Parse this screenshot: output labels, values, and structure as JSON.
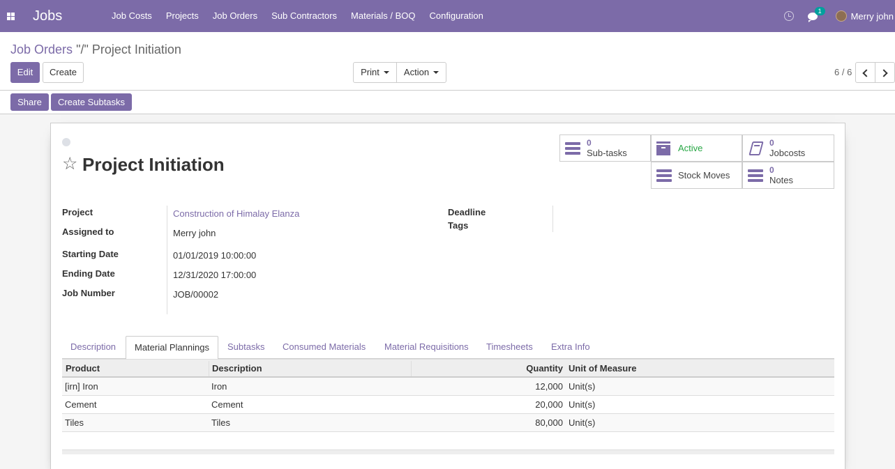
{
  "navbar": {
    "brand": "Jobs",
    "menu": [
      "Job Costs",
      "Projects",
      "Job Orders",
      "Sub Contractors",
      "Materials / BOQ",
      "Configuration"
    ],
    "chat_count": "1",
    "user_name": "Merry john"
  },
  "breadcrumb": {
    "parent": "Job Orders",
    "current": "\"/\" Project Initiation"
  },
  "actions": {
    "edit": "Edit",
    "create": "Create",
    "print": "Print",
    "action": "Action",
    "pager": "6 / 6"
  },
  "header_buttons": {
    "share": "Share",
    "create_subtasks": "Create Subtasks"
  },
  "smart_buttons": {
    "subtasks_count": "0",
    "subtasks_label": "Sub-tasks",
    "active_label": "Active",
    "jobcosts_count": "0",
    "jobcosts_label": "Jobcosts",
    "stock_moves_label": "Stock Moves",
    "notes_count": "0",
    "notes_label": "Notes"
  },
  "record": {
    "title": "Project Initiation"
  },
  "fields": {
    "project_label": "Project",
    "project_value": "Construction of Himalay Elanza",
    "assigned_label": "Assigned to",
    "assigned_value": "Merry john",
    "start_label": "Starting Date",
    "start_value": "01/01/2019 10:00:00",
    "end_label": "Ending Date",
    "end_value": "12/31/2020 17:00:00",
    "jobnum_label": "Job Number",
    "jobnum_value": "JOB/00002",
    "deadline_label": "Deadline",
    "tags_label": "Tags"
  },
  "tabs": [
    "Description",
    "Material Plannings",
    "Subtasks",
    "Consumed Materials",
    "Material Requisitions",
    "Timesheets",
    "Extra Info"
  ],
  "table": {
    "headers": [
      "Product",
      "Description",
      "Quantity",
      "Unit of Measure"
    ],
    "rows": [
      [
        "[irn] Iron",
        "Iron",
        "12,000",
        "Unit(s)"
      ],
      [
        "Cement",
        "Cement",
        "20,000",
        "Unit(s)"
      ],
      [
        "Tiles",
        "Tiles",
        "80,000",
        "Unit(s)"
      ]
    ]
  },
  "colors": {
    "brand": "#7c6ba8",
    "active_status": "#28a745",
    "badge": "#00a09d"
  }
}
